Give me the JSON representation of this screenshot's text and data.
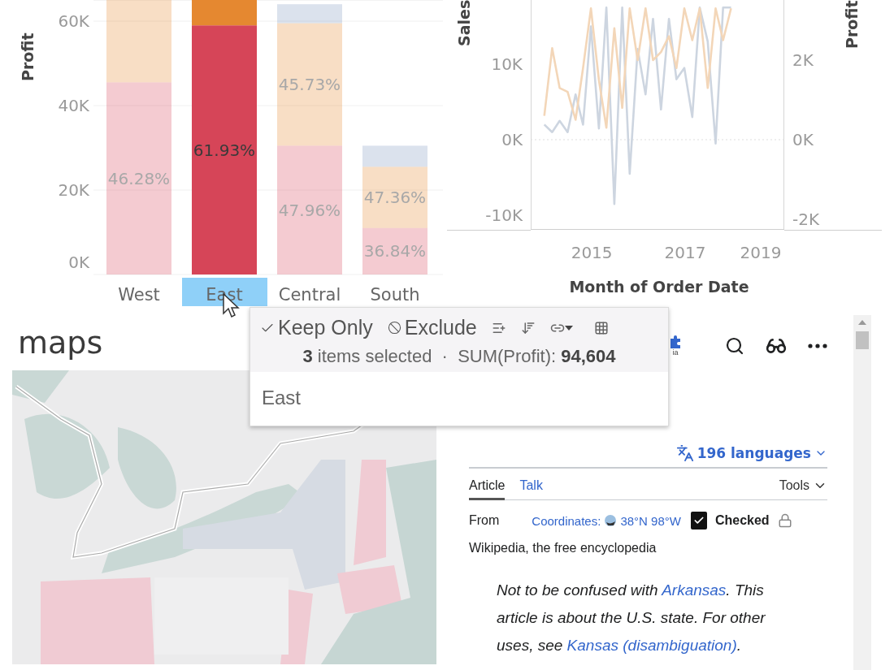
{
  "bar_chart": {
    "y_title": "Profit",
    "category_selected": [
      false,
      true,
      false,
      false
    ],
    "chart_data": {
      "type": "bar",
      "stacked": true,
      "grid": true,
      "categories": [
        "West",
        "East",
        "Central",
        "South"
      ],
      "ylim": [
        0,
        65000
      ],
      "yticks": [
        {
          "value": 0,
          "label": "0K"
        },
        {
          "value": 20000,
          "label": "20K"
        },
        {
          "value": 40000,
          "label": "40K"
        },
        {
          "value": 60000,
          "label": "60K"
        }
      ],
      "series": [
        {
          "color": "#d64558",
          "values": [
            45500,
            59000,
            30500,
            11000
          ]
        },
        {
          "color": "#e58830",
          "values": [
            19500,
            6000,
            29000,
            14500
          ]
        },
        {
          "color": "#7f98be",
          "values": [
            null,
            null,
            4500,
            5000
          ]
        }
      ],
      "value_labels": [
        [
          "46.28%",
          "61.93%",
          "47.96%",
          "36.84%"
        ],
        [
          null,
          null,
          "45.73%",
          "47.36%"
        ],
        [
          null,
          null,
          null,
          null
        ]
      ]
    }
  },
  "line_chart": {
    "right_title": "Profit",
    "chart_data": {
      "type": "line",
      "xlabel": "Month of Order Date",
      "ylabel": "Sales",
      "xlim": [
        2013.71,
        2019.14
      ],
      "xticks": [
        2015,
        2017,
        2019
      ],
      "ylim": [
        -11935,
        18495
      ],
      "yticks": [
        {
          "value": -10000,
          "label": "-10K"
        },
        {
          "value": 0,
          "label": "0K"
        },
        {
          "value": 10000,
          "label": "10K"
        }
      ],
      "y2lim": [
        -2265,
        3510
      ],
      "y2ticks": [
        {
          "value": -2000,
          "label": "-2K"
        },
        {
          "value": 0,
          "label": "0K"
        },
        {
          "value": 2000,
          "label": "2K"
        }
      ],
      "x": [
        2014,
        2014.17,
        2014.33,
        2014.5,
        2014.67,
        2014.83,
        2015,
        2015.17,
        2015.33,
        2015.5,
        2015.67,
        2015.83,
        2016,
        2016.17,
        2016.33,
        2016.5,
        2016.67,
        2016.83,
        2017,
        2017.17,
        2017.33,
        2017.5,
        2017.67,
        2017.83,
        2018
      ],
      "series": [
        {
          "color": "#cdd5e0",
          "values": [
            2000,
            1000,
            2500,
            1000,
            6000,
            2000,
            15000,
            1500,
            17500,
            -8500,
            17500,
            -4500,
            12000,
            6000,
            16000,
            4000,
            16000,
            8000,
            9500,
            3000,
            17500,
            13000,
            -500,
            17500,
            17500
          ]
        },
        {
          "color": "#f3d6b8",
          "axis": "y2",
          "values": [
            600,
            2300,
            1300,
            1200,
            500,
            1800,
            3300,
            1500,
            300,
            2800,
            800,
            3300,
            2000,
            3300,
            2000,
            2200,
            2600,
            1800,
            3300,
            2500,
            3300,
            1300,
            3300,
            2500,
            3300
          ]
        }
      ]
    }
  },
  "maps": {
    "title": "maps"
  },
  "tooltip": {
    "actions": [
      {
        "kind": "keep",
        "label": "Keep Only"
      },
      {
        "kind": "exclude",
        "label": "Exclude"
      }
    ],
    "summary": "**3** items selected  ·  SUM(Profit): **94,604**",
    "value": "East"
  },
  "wiki": {
    "logo_fragment": "ia",
    "languages": "196 languages",
    "tabs": [
      {
        "label": "Article",
        "selected": true
      },
      {
        "label": "Talk",
        "selected": false
      }
    ],
    "tools": "Tools",
    "from": "From",
    "coordinates_label": "Coordinates:",
    "coordinates": "38°N 98°W",
    "checked": {
      "label": "Checked",
      "checked": true
    },
    "tagline": "Wikipedia, the free encyclopedia",
    "hatnote": [
      {
        "kind": "text",
        "text": "Not to be confused with "
      },
      {
        "kind": "link",
        "text": "Arkansas"
      },
      {
        "kind": "text",
        "text": ". This article is about the U.S. state. For other uses, see "
      },
      {
        "kind": "link",
        "text": "Kansas (disambiguation)"
      },
      {
        "kind": "text",
        "text": "."
      }
    ]
  }
}
